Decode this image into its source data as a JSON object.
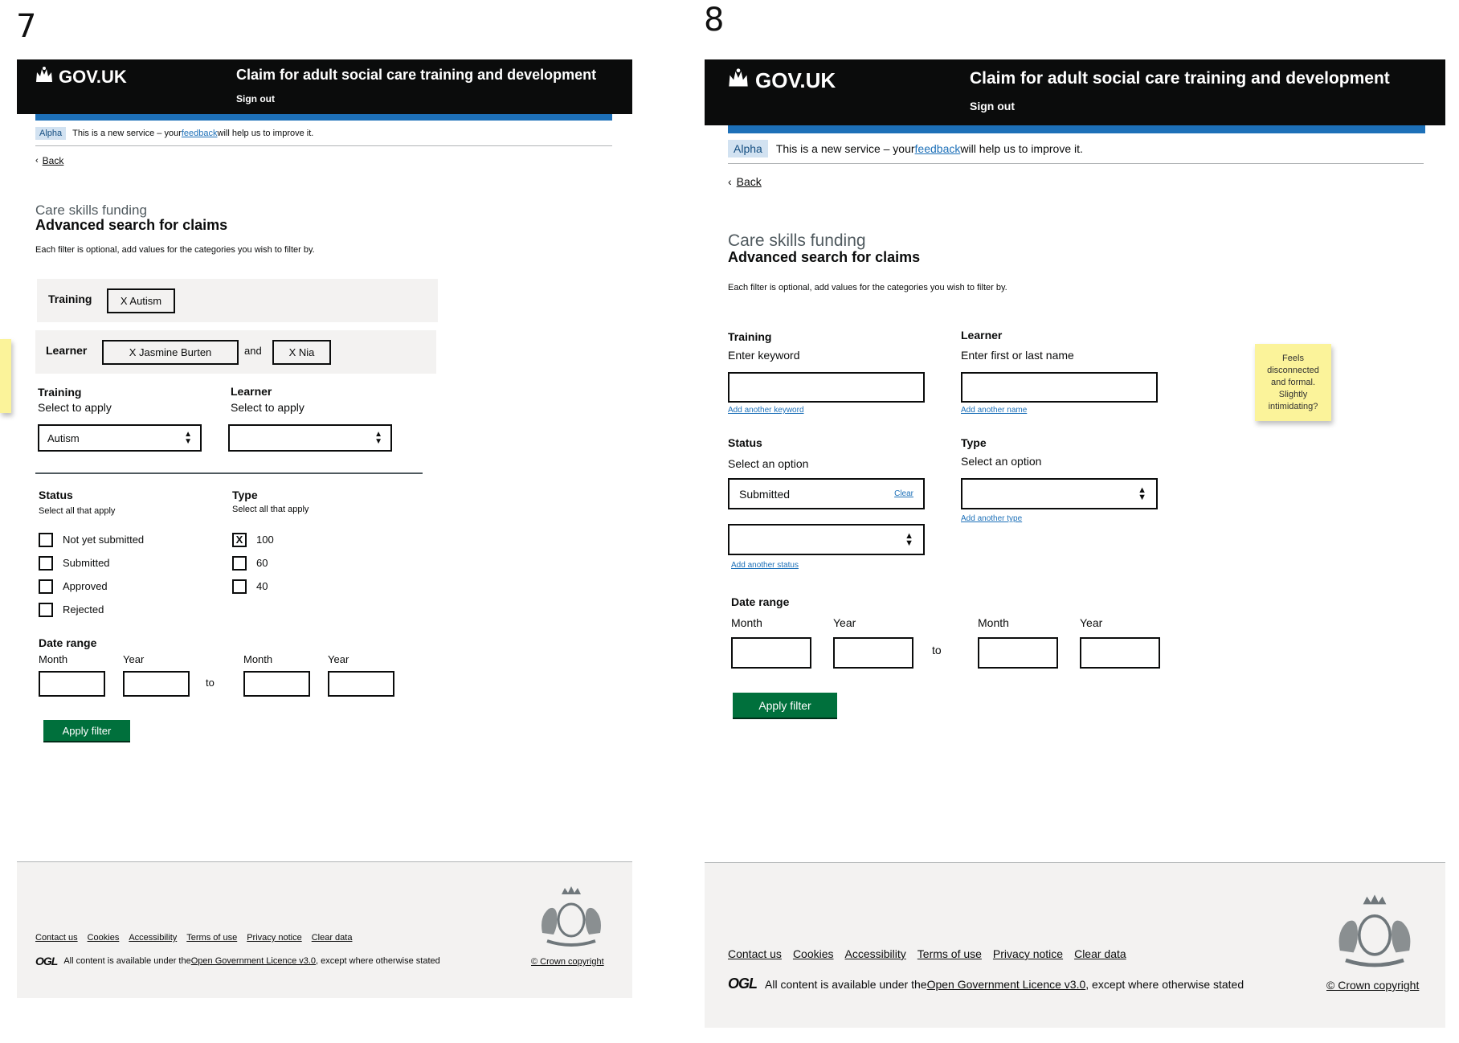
{
  "screens": [
    {
      "number": "7",
      "header": {
        "logo": "GOV.UK",
        "service_name": "Claim for adult social care training and development",
        "sign_out": "Sign out"
      },
      "phase_banner": {
        "tag": "Alpha",
        "text_before": "This is a new service – your ",
        "link": "feedback",
        "text_after": " will help us to improve it."
      },
      "back": "Back",
      "caption": "Care skills funding",
      "title": "Advanced search for claims",
      "intro": "Each filter is optional, add values for the categories you wish to filter by.",
      "applied": {
        "training_label": "Training",
        "training_chip": "X Autism",
        "learner_label": "Learner",
        "learner_chip_1": "X Jasmine Burten",
        "and": "and",
        "learner_chip_2": "X Nia"
      },
      "training_select": {
        "label": "Training",
        "hint": "Select to apply",
        "value": "Autism"
      },
      "learner_select": {
        "label": "Learner",
        "hint": "Select to apply",
        "value": ""
      },
      "status": {
        "label": "Status",
        "hint": "Select all that apply",
        "options": [
          {
            "label": "Not yet submitted",
            "checked": false
          },
          {
            "label": "Submitted",
            "checked": false
          },
          {
            "label": "Approved",
            "checked": false
          },
          {
            "label": "Rejected",
            "checked": false
          }
        ]
      },
      "type": {
        "label": "Type",
        "hint": "Select all that apply",
        "options": [
          {
            "label": "100",
            "checked": true,
            "mark": "X"
          },
          {
            "label": "60",
            "checked": false,
            "mark": ""
          },
          {
            "label": "40",
            "checked": false,
            "mark": ""
          }
        ]
      },
      "date_range": {
        "label": "Date range",
        "month": "Month",
        "year": "Year",
        "to": "to"
      },
      "apply": "Apply filter",
      "footer": {
        "links": [
          "Contact us",
          "Cookies",
          "Accessibility",
          "Terms of use",
          "Privacy notice",
          "Clear data"
        ],
        "ogl": "OGL",
        "licence_before": "All content is available under the ",
        "licence_link": "Open Government Licence v3.0",
        "licence_after": ", except where otherwise stated",
        "copyright": "© Crown copyright"
      }
    },
    {
      "number": "8",
      "header": {
        "logo": "GOV.UK",
        "service_name": "Claim for adult social care training and development",
        "sign_out": "Sign out"
      },
      "phase_banner": {
        "tag": "Alpha",
        "text_before": "This is a new service – your ",
        "link": "feedback",
        "text_after": " will help us to improve it."
      },
      "back": "Back",
      "caption": "Care skills funding",
      "title": "Advanced search for claims",
      "intro": "Each filter is optional, add values for the categories you wish to filter by.",
      "training": {
        "label": "Training",
        "hint": "Enter keyword",
        "value": "",
        "add_link": "Add another keyword"
      },
      "learner": {
        "label": "Learner",
        "hint": "Enter first or last name",
        "value": "",
        "add_link": "Add another name"
      },
      "status": {
        "label": "Status",
        "hint": "Select an option",
        "value": "Submitted",
        "clear": "Clear",
        "second_value": "",
        "add_link": "Add another status"
      },
      "type": {
        "label": "Type",
        "hint": "Select an option",
        "value": "",
        "add_link": "Add another type"
      },
      "date_range": {
        "label": "Date range",
        "month": "Month",
        "year": "Year",
        "to": "to"
      },
      "apply": "Apply filter",
      "sticky_note": "Feels disconnected and formal. Slightly intimidating?",
      "footer": {
        "links": [
          "Contact us",
          "Cookies",
          "Accessibility",
          "Terms of use",
          "Privacy notice",
          "Clear data"
        ],
        "ogl": "OGL",
        "licence_before": "All content is available under the ",
        "licence_link": "Open Government Licence v3.0",
        "licence_after": ", except where otherwise stated",
        "copyright": "© Crown copyright"
      }
    }
  ],
  "colors": {
    "header": "#0b0c0c",
    "accent_bar": "#1d70b8",
    "button": "#00703c",
    "tag_bg": "#d2e2f1",
    "footer_bg": "#f3f2f1",
    "sticky": "#fbf39a"
  }
}
